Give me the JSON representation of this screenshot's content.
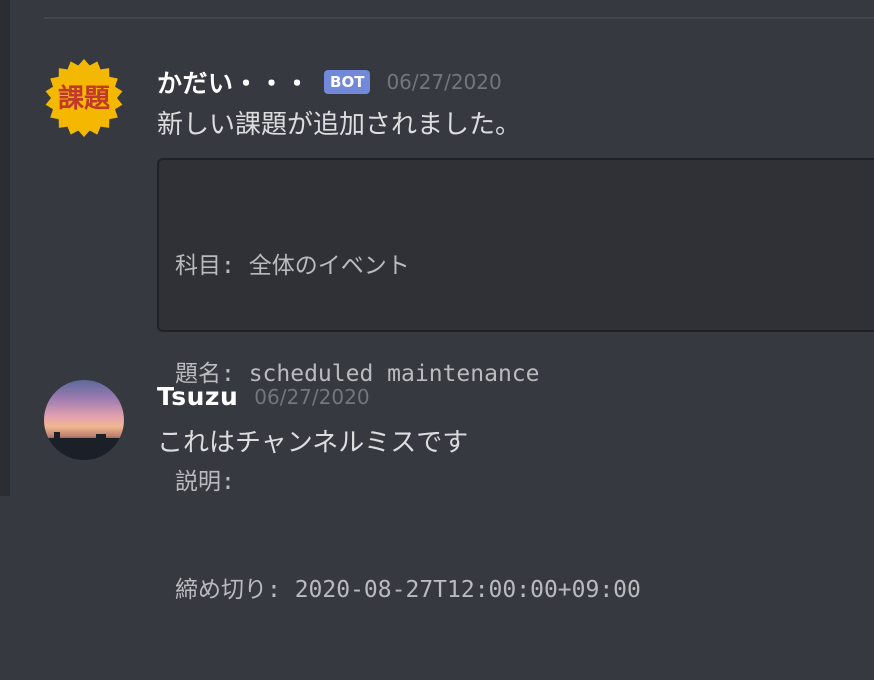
{
  "messages": [
    {
      "username": "かだい・・・",
      "tag": "BOT",
      "timestamp": "06/27/2020",
      "avatar_text": "課題",
      "content": "新しい課題が追加されました。",
      "code_lines": [
        "科目: 全体のイベント",
        "題名: scheduled maintenance",
        "説明:",
        "締め切り: 2020-08-27T12:00:00+09:00"
      ]
    },
    {
      "username": "Tsuzu",
      "timestamp": "06/27/2020",
      "content": "これはチャンネルミスです"
    }
  ],
  "colors": {
    "background": "#36393f",
    "bot_tag": "#7289da",
    "avatar_badge": "#f5b800",
    "avatar_text": "#c0392b"
  }
}
